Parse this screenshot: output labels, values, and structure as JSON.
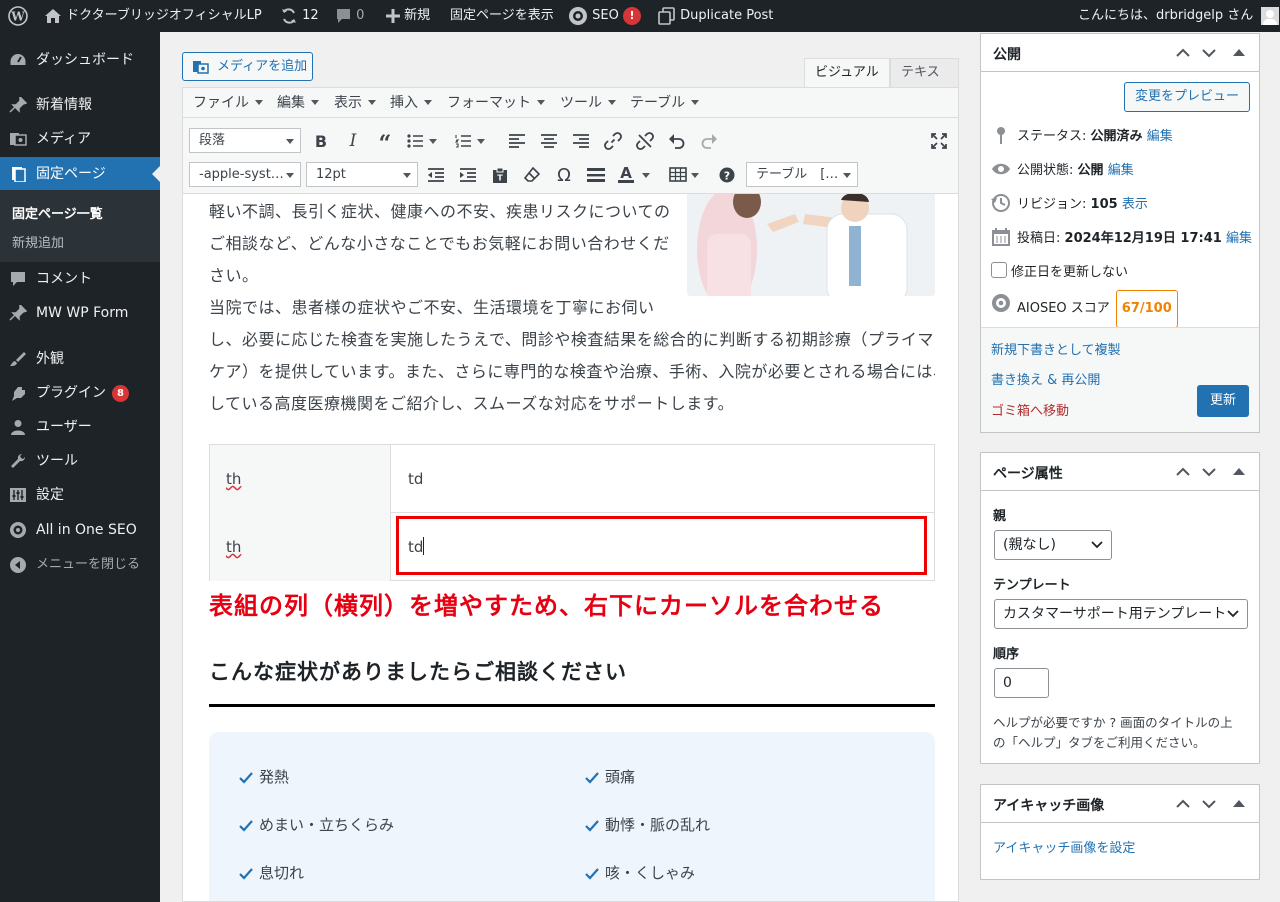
{
  "adminbar": {
    "site_name": "ドクターブリッジオフィシャルLP",
    "updates_count": "12",
    "comments_count": "0",
    "new_label": "新規",
    "view_page": "固定ページを表示",
    "seo_label": "SEO",
    "seo_badge": "!",
    "duplicate_post": "Duplicate Post",
    "greeting": "こんにちは、drbridgelp さん"
  },
  "sidebar": {
    "items": [
      {
        "label": "ダッシュボード",
        "icon": "dashboard-icon"
      },
      {
        "label": "新着情報",
        "icon": "pin-icon"
      },
      {
        "label": "メディア",
        "icon": "media-icon"
      },
      {
        "label": "固定ページ",
        "icon": "page-icon"
      },
      {
        "label": "コメント",
        "icon": "comment-icon"
      },
      {
        "label": "MW WP Form",
        "icon": "pin-icon"
      },
      {
        "label": "外観",
        "icon": "brush-icon"
      },
      {
        "label": "プラグイン",
        "icon": "plugin-icon",
        "badge": "8"
      },
      {
        "label": "ユーザー",
        "icon": "user-icon"
      },
      {
        "label": "ツール",
        "icon": "wrench-icon"
      },
      {
        "label": "設定",
        "icon": "settings-icon"
      },
      {
        "label": "All in One SEO",
        "icon": "aioseo-icon"
      },
      {
        "label": "メニューを閉じる",
        "icon": "collapse-icon"
      }
    ],
    "submenu": {
      "current": "固定ページ一覧",
      "add_new": "新規追加"
    }
  },
  "editor": {
    "add_media": "メディアを追加",
    "tab_visual": "ビジュアル",
    "tab_text": "テキスト",
    "menubar": [
      "ファイル",
      "編集",
      "表示",
      "挿入",
      "フォーマット",
      "ツール",
      "テーブル"
    ],
    "format_select": "段落",
    "font_select": "-apple-syst…",
    "size_select": "12pt",
    "table_select": "テーブル　[…",
    "paragraphs": [
      "軽い不調、長引く症状、健康への不安、疾患リスクについての",
      "ご相談など、どんな小さなことでもお気軽にお問い合わせくだ",
      "さい。",
      "当院では、患者様の症状やご不安、生活環境を丁寧にお伺い",
      "し、必要に応じた検査を実施したうえで、問診や検査結果を総合的に判断する初期診療（プライマリ・",
      "ケア）を提供しています。また、さらに専門的な検査や治療、手術、入院が必要とされる場合には、連携",
      "している高度医療機関をご紹介し、スムーズな対応をサポートします。"
    ],
    "table": [
      {
        "th": "th",
        "td": "td"
      },
      {
        "th": "th",
        "td": "td"
      }
    ],
    "annotation": "表組の列（横列）を増やすため、右下にカーソルを合わせる",
    "heading": "こんな症状がありましたらご相談ください",
    "symptoms": [
      "発熱",
      "頭痛",
      "めまい・立ちくらみ",
      "動悸・脈の乱れ",
      "息切れ",
      "咳・くしゃみ"
    ]
  },
  "publish": {
    "title": "公開",
    "preview": "変更をプレビュー",
    "status_label": "ステータス:",
    "status_value": "公開済み",
    "visibility_label": "公開状態:",
    "visibility_value": "公開",
    "revision_label": "リビジョン:",
    "revision_value": "105",
    "revision_link": "表示",
    "date_label": "投稿日:",
    "date_value": "2024年12月19日 17:41",
    "edit": "編集",
    "no_update_date": "修正日を更新しない",
    "aioseo_label": "AIOSEO スコア",
    "aioseo_score": "67/100",
    "copy_draft": "新規下書きとして複製",
    "rewrite": "書き換え & 再公開",
    "trash": "ゴミ箱へ移動",
    "update": "更新"
  },
  "page_attributes": {
    "title": "ページ属性",
    "parent_label": "親",
    "parent_value": "(親なし)",
    "template_label": "テンプレート",
    "template_value": "カスタマーサポート用テンプレート",
    "order_label": "順序",
    "order_value": "0",
    "help": [
      "ヘルプが必要ですか ? 画面のタイトルの上",
      "の「ヘルプ」タブをご利用ください。"
    ]
  },
  "featured_image": {
    "title": "アイキャッチ画像",
    "set_link": "アイキャッチ画像を設定"
  },
  "colors": {
    "admin_dark": "#1d2327",
    "accent_blue": "#2271b1",
    "annotation_red": "#e60012",
    "score_orange": "#f18200"
  }
}
